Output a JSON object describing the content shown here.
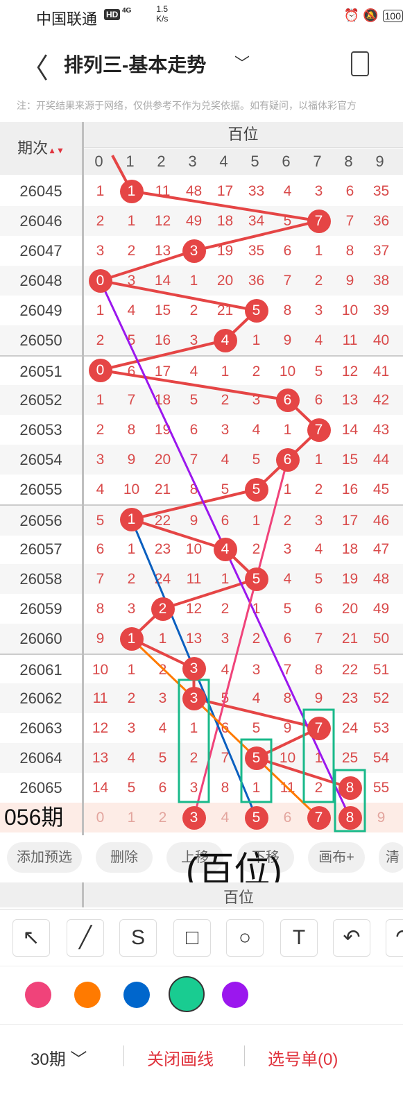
{
  "status": {
    "carrier": "中国联通",
    "hd": "HD",
    "net": "4G",
    "speed": "1.5\nK/s",
    "battery": "100"
  },
  "header": {
    "title": "排列三-基本走势"
  },
  "notice": "注：开奖结果来源于网络，仅供参考不作为兑奖依据。如有疑问，以福体彩官方",
  "grid": {
    "period_header": "期次",
    "section_header": "百位",
    "digits": [
      "0",
      "1",
      "2",
      "3",
      "4",
      "5",
      "6",
      "7",
      "8",
      "9"
    ],
    "rows": [
      {
        "period": "26045",
        "cells": [
          "1",
          "1",
          "11",
          "48",
          "17",
          "33",
          "4",
          "3",
          "6",
          "35"
        ],
        "hit": 1
      },
      {
        "period": "26046",
        "cells": [
          "2",
          "1",
          "12",
          "49",
          "18",
          "34",
          "5",
          "7",
          "7",
          "36"
        ],
        "hit": 7
      },
      {
        "period": "26047",
        "cells": [
          "3",
          "2",
          "13",
          "3",
          "19",
          "35",
          "6",
          "1",
          "8",
          "37"
        ],
        "hit": 3
      },
      {
        "period": "26048",
        "cells": [
          "0",
          "3",
          "14",
          "1",
          "20",
          "36",
          "7",
          "2",
          "9",
          "38"
        ],
        "hit": 0
      },
      {
        "period": "26049",
        "cells": [
          "1",
          "4",
          "15",
          "2",
          "21",
          "5",
          "8",
          "3",
          "10",
          "39"
        ],
        "hit": 5
      },
      {
        "period": "26050",
        "cells": [
          "2",
          "5",
          "16",
          "3",
          "4",
          "1",
          "9",
          "4",
          "11",
          "40"
        ],
        "hit": 4
      },
      {
        "period": "26051",
        "cells": [
          "0",
          "6",
          "17",
          "4",
          "1",
          "2",
          "10",
          "5",
          "12",
          "41"
        ],
        "hit": 0
      },
      {
        "period": "26052",
        "cells": [
          "1",
          "7",
          "18",
          "5",
          "2",
          "3",
          "6",
          "6",
          "13",
          "42"
        ],
        "hit": 6
      },
      {
        "period": "26053",
        "cells": [
          "2",
          "8",
          "19",
          "6",
          "3",
          "4",
          "1",
          "7",
          "14",
          "43"
        ],
        "hit": 7
      },
      {
        "period": "26054",
        "cells": [
          "3",
          "9",
          "20",
          "7",
          "4",
          "5",
          "6",
          "1",
          "15",
          "44"
        ],
        "hit": 6
      },
      {
        "period": "26055",
        "cells": [
          "4",
          "10",
          "21",
          "8",
          "5",
          "5",
          "1",
          "2",
          "16",
          "45"
        ],
        "hit": 5
      },
      {
        "period": "26056",
        "cells": [
          "5",
          "1",
          "22",
          "9",
          "6",
          "1",
          "2",
          "3",
          "17",
          "46"
        ],
        "hit": 1
      },
      {
        "period": "26057",
        "cells": [
          "6",
          "1",
          "23",
          "10",
          "4",
          "2",
          "3",
          "4",
          "18",
          "47"
        ],
        "hit": 4
      },
      {
        "period": "26058",
        "cells": [
          "7",
          "2",
          "24",
          "11",
          "1",
          "5",
          "4",
          "5",
          "19",
          "48"
        ],
        "hit": 5
      },
      {
        "period": "26059",
        "cells": [
          "8",
          "3",
          "2",
          "12",
          "2",
          "1",
          "5",
          "6",
          "20",
          "49"
        ],
        "hit": 2
      },
      {
        "period": "26060",
        "cells": [
          "9",
          "1",
          "1",
          "13",
          "3",
          "2",
          "6",
          "7",
          "21",
          "50"
        ],
        "hit": 1
      },
      {
        "period": "26061",
        "cells": [
          "10",
          "1",
          "2",
          "3",
          "4",
          "3",
          "7",
          "8",
          "22",
          "51"
        ],
        "hit": 3
      },
      {
        "period": "26062",
        "cells": [
          "11",
          "2",
          "3",
          "3",
          "5",
          "4",
          "8",
          "9",
          "23",
          "52"
        ],
        "hit": 3
      },
      {
        "period": "26063",
        "cells": [
          "12",
          "3",
          "4",
          "1",
          "6",
          "5",
          "9",
          "7",
          "24",
          "53"
        ],
        "hit": 7
      },
      {
        "period": "26064",
        "cells": [
          "13",
          "4",
          "5",
          "2",
          "7",
          "5",
          "10",
          "1",
          "25",
          "54"
        ],
        "hit": 5
      },
      {
        "period": "26065",
        "cells": [
          "14",
          "5",
          "6",
          "3",
          "8",
          "1",
          "11",
          "2",
          "8",
          "55"
        ],
        "hit": 8
      }
    ],
    "prediction": {
      "label": "056期",
      "cells": [
        "0",
        "1",
        "2",
        "3",
        "4",
        "5",
        "6",
        "7",
        "8",
        "9"
      ],
      "picks": [
        3,
        5,
        7,
        8
      ]
    }
  },
  "buttons": [
    "添加预选",
    "删除",
    "上移",
    "下移",
    "画布+",
    "清"
  ],
  "overlay_text": "(百位)",
  "sub_header": "百位",
  "tools": [
    "↖",
    "╱",
    "S",
    "□",
    "○",
    "T",
    "↶",
    "↷"
  ],
  "colors": [
    "#f0437a",
    "#ff7a00",
    "#0066cc",
    "#19cc91",
    "#9b17ee"
  ],
  "selected_color": "#19cc91",
  "line_colors": {
    "trend": "#e54545",
    "purple": "#9b17ee",
    "pink": "#f0437a",
    "blue": "#0b5fbf",
    "orange": "#ff7a00",
    "green_box": "#19b98a"
  },
  "bottom": {
    "periods": "30期",
    "close": "关闭画线",
    "pick": "选号单(0)"
  }
}
